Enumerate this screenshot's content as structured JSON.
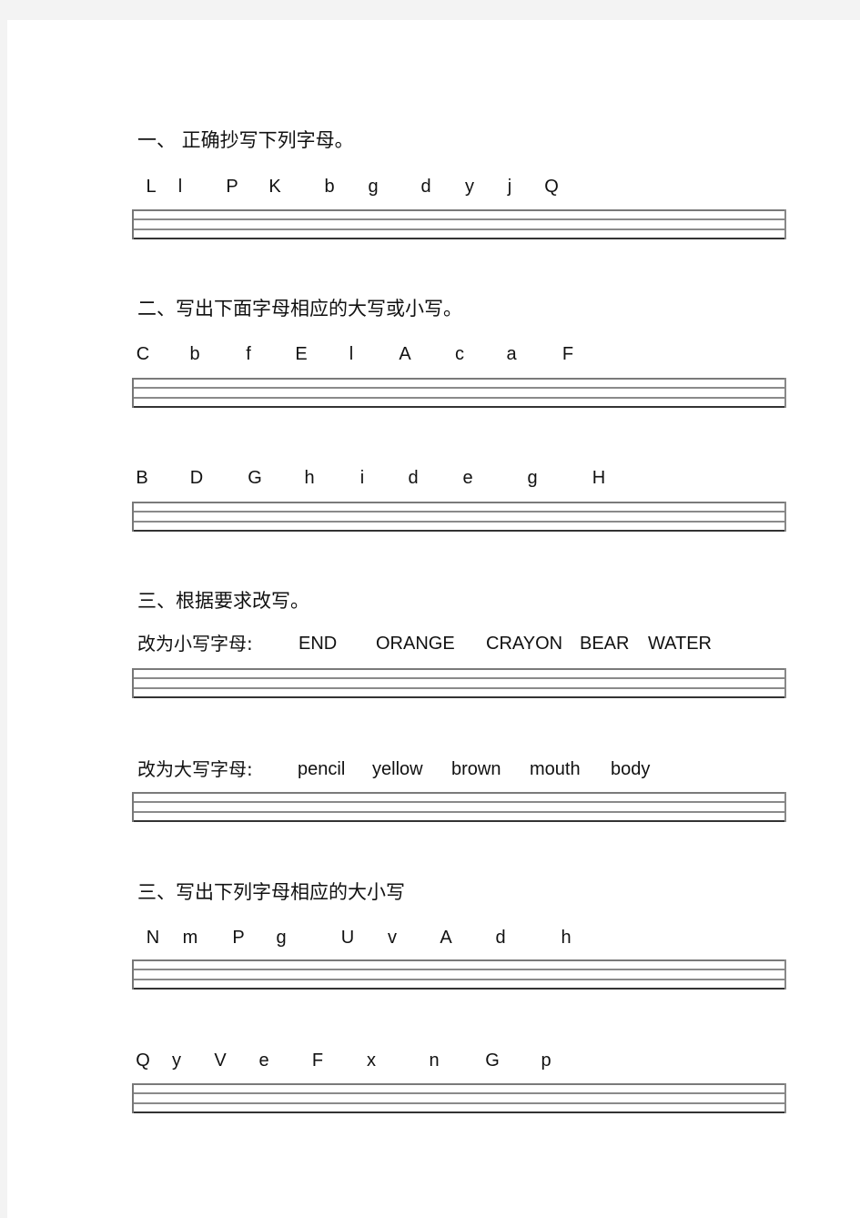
{
  "sections": [
    {
      "title": "一、  正确抄写下列字母。",
      "rows": [
        [
          "L",
          "l",
          "P",
          "K",
          "b",
          "g",
          "d",
          "y",
          "j",
          "Q"
        ]
      ]
    },
    {
      "title": "二、写出下面字母相应的大写或小写。",
      "rows": [
        [
          "C",
          "b",
          "f",
          "E",
          "l",
          "A",
          "c",
          "a",
          "F"
        ],
        [
          "B",
          "D",
          "G",
          "h",
          "i",
          "d",
          "e",
          "g",
          "H"
        ]
      ]
    },
    {
      "title": "三、根据要求改写。",
      "subsections": [
        {
          "label": "改为小写字母:",
          "words": [
            "END",
            "ORANGE",
            "CRAYON",
            "BEAR",
            "WATER"
          ]
        },
        {
          "label": "改为大写字母:",
          "words": [
            "pencil",
            "yellow",
            "brown",
            "mouth",
            "body"
          ]
        }
      ]
    },
    {
      "title": "三、写出下列字母相应的大小写",
      "rows": [
        [
          "N",
          "m",
          "P",
          "g",
          "U",
          "v",
          "A",
          "d",
          "h"
        ],
        [
          "Q",
          "y",
          "V",
          "e",
          "F",
          "x",
          "n",
          "G",
          "p"
        ]
      ]
    }
  ]
}
